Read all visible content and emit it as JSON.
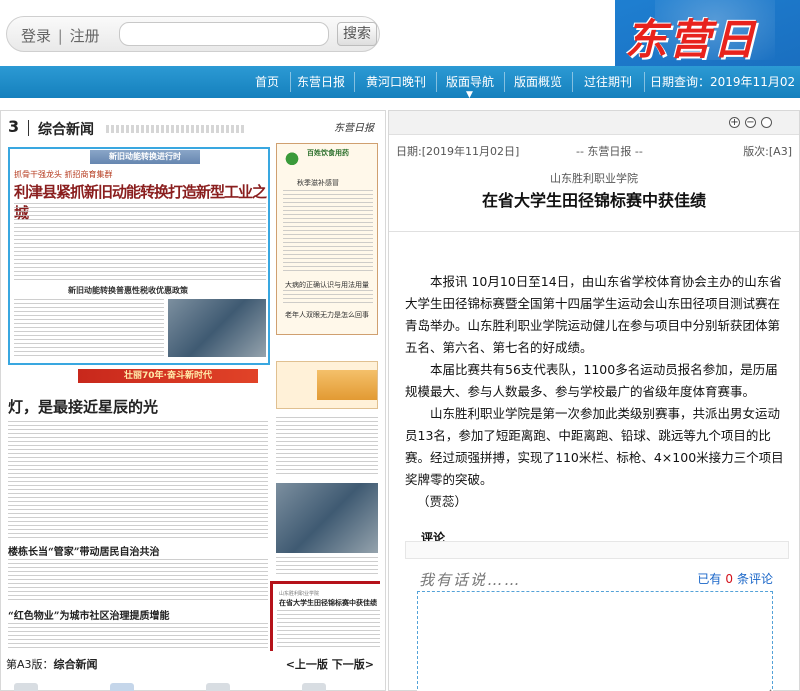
{
  "header": {
    "login_label": "登录",
    "register_label": "注册",
    "search_button": "搜索",
    "search_input_value": "",
    "logo_text": "东营日报"
  },
  "nav": {
    "items": [
      "首页",
      "东营日报",
      "黄河口晚刊",
      "版面导航",
      "版面概览",
      "过往期刊"
    ],
    "date_label": "日期查询：",
    "date_value": "2019年11月02日",
    "date_arrow": "▼",
    "active_indicator": "▼"
  },
  "newspaper": {
    "page_number": "3",
    "section_name": "综合新闻",
    "brand": "东营日报",
    "blue_box_header": "新旧动能转换进行时",
    "kicker": "抓骨干强龙头  抓招商育集群",
    "headline1": "利津县紧抓新旧动能转换打造新型工业之城",
    "headline2": "新旧动能转换普惠性税收优惠政策",
    "banner": "壮丽70年·奋斗新时代",
    "headline3": "灯，是最接近星辰的光",
    "headline4": "楼栋长当“管家”带动居民自治共治",
    "headline5": "“红色物业”为城市社区治理提质增能",
    "ad_title": "百姓饮食用药",
    "ad_sub1": "秋季滋补感冒",
    "ad_sub2": "大病的正确认识与用法用量",
    "ad_sub3": "老年人双眼无力是怎么回事",
    "highlight_small": "山东胜利职业学院",
    "highlight_title": "在省大学生田径锦标赛中获佳绩"
  },
  "page_footer": {
    "version_prefix": "第A3版：",
    "version_name": "综合新闻",
    "prev": "<上一版",
    "next": "下一版>"
  },
  "article": {
    "date": "日期:[2019年11月02日]",
    "source": "-- 东营日报 --",
    "edition": "版次:[A3]",
    "subtitle": "山东胜利职业学院",
    "title": "在省大学生田径锦标赛中获佳绩",
    "paragraphs": [
      "本报讯  10月10日至14日，由山东省学校体育协会主办的山东省大学生田径锦标赛暨全国第十四届学生运动会山东田径项目测试赛在青岛举办。山东胜利职业学院运动健儿在参与项目中分别斩获团体第五名、第六名、第七名的好成绩。",
      "本届比赛共有56支代表队，1100多名运动员报名参加，是历届规模最大、参与人数最多、参与学校最广的省级年度体育赛事。",
      "山东胜利职业学院是第一次参加此类级别赛事，共派出男女运动员13名，参加了短距离跑、中距离跑、铅球、跳远等九个项目的比赛。经过顽强拼搏，实现了110米栏、标枪、4×100米接力三个项目奖牌零的突破。"
    ],
    "author": "（贾蕊）"
  },
  "comments": {
    "label": "评论",
    "hint": "我有话说……",
    "count_prefix": "已有",
    "count": "0",
    "count_suffix": "条评论"
  },
  "colors": {
    "nav_blue": "#1a8ac9",
    "logo_bg": "#1a6fc0",
    "logo_red": "#e8231d",
    "highlight_red": "#b5121a",
    "comment_count": "#d3101a"
  }
}
